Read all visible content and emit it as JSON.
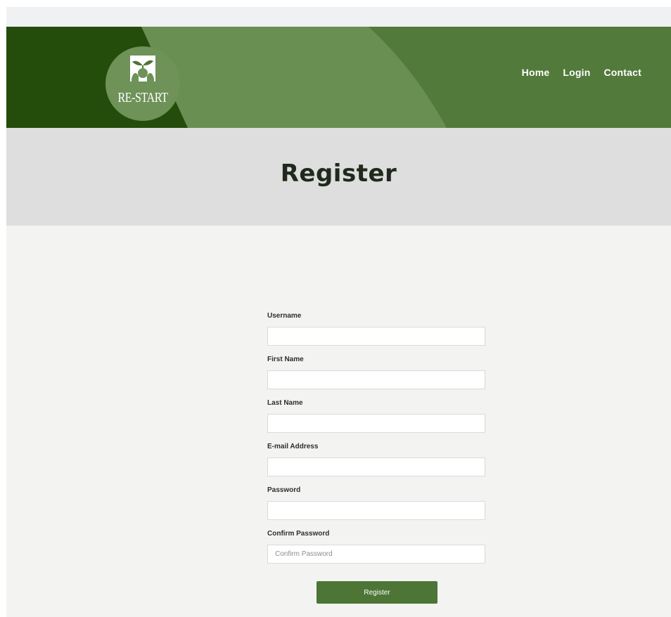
{
  "brand": {
    "logo_text": "RE-START"
  },
  "nav": {
    "items": [
      "Home",
      "Login",
      "Contact"
    ]
  },
  "page": {
    "title": "Register"
  },
  "form": {
    "fields": [
      {
        "label": "Username",
        "value": "",
        "placeholder": ""
      },
      {
        "label": "First Name",
        "value": "",
        "placeholder": ""
      },
      {
        "label": "Last Name",
        "value": "",
        "placeholder": ""
      },
      {
        "label": "E-mail Address",
        "value": "",
        "placeholder": ""
      },
      {
        "label": "Password",
        "value": "",
        "placeholder": ""
      },
      {
        "label": "Confirm Password",
        "value": "",
        "placeholder": "Confirm Password"
      }
    ],
    "submit_label": "Register"
  },
  "colors": {
    "header_green": "#527a3a",
    "header_dark": "#244d0b",
    "header_light": "#6a8f52",
    "button": "#4d7536",
    "banner": "#dededf",
    "main_bg": "#f3f4f2"
  }
}
